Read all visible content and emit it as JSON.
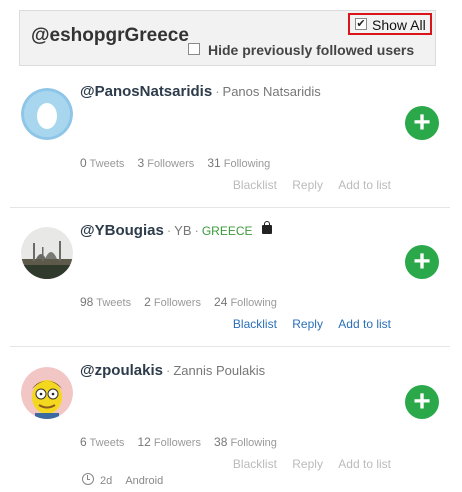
{
  "header": {
    "account_handle": "@eshopgrGreece",
    "show_all_label": "Show All",
    "show_all_checked": true,
    "hide_followed_label": "Hide previously followed users",
    "hide_followed_checked": false
  },
  "users": [
    {
      "handle": "@PanosNatsaridis",
      "full_name": "Panos Natsaridis",
      "location": "",
      "tweets": "0",
      "followers": "3",
      "following": "31",
      "tweets_label": "Tweets",
      "followers_label": "Followers",
      "following_label": "Following",
      "actions": [
        "Blacklist",
        "Reply",
        "Add to list"
      ],
      "actions_active": false,
      "avatar": "egg-avatar-icon"
    },
    {
      "handle": "@YBougias",
      "full_name": "YB",
      "location": "GREECE",
      "tweets": "98",
      "followers": "2",
      "following": "24",
      "tweets_label": "Tweets",
      "followers_label": "Followers",
      "following_label": "Following",
      "actions": [
        "Blacklist",
        "Reply",
        "Add to list"
      ],
      "actions_active": true,
      "protected_icon": "lock-icon",
      "avatar": "mosque-photo-avatar"
    },
    {
      "handle": "@zpoulakis",
      "full_name": "Zannis Poulakis",
      "location": "",
      "tweets": "6",
      "followers": "12",
      "following": "38",
      "tweets_label": "Tweets",
      "followers_label": "Followers",
      "following_label": "Following",
      "actions": [
        "Blacklist",
        "Reply",
        "Add to list"
      ],
      "actions_active": false,
      "avatar": "cartoon-avatar",
      "last_tweet_age": "2d",
      "source": "Android"
    }
  ],
  "colors": {
    "follow": "#2aa84a",
    "link": "#2a6fb8",
    "location": "#3c9a3c",
    "highlight": "#d9141b"
  }
}
